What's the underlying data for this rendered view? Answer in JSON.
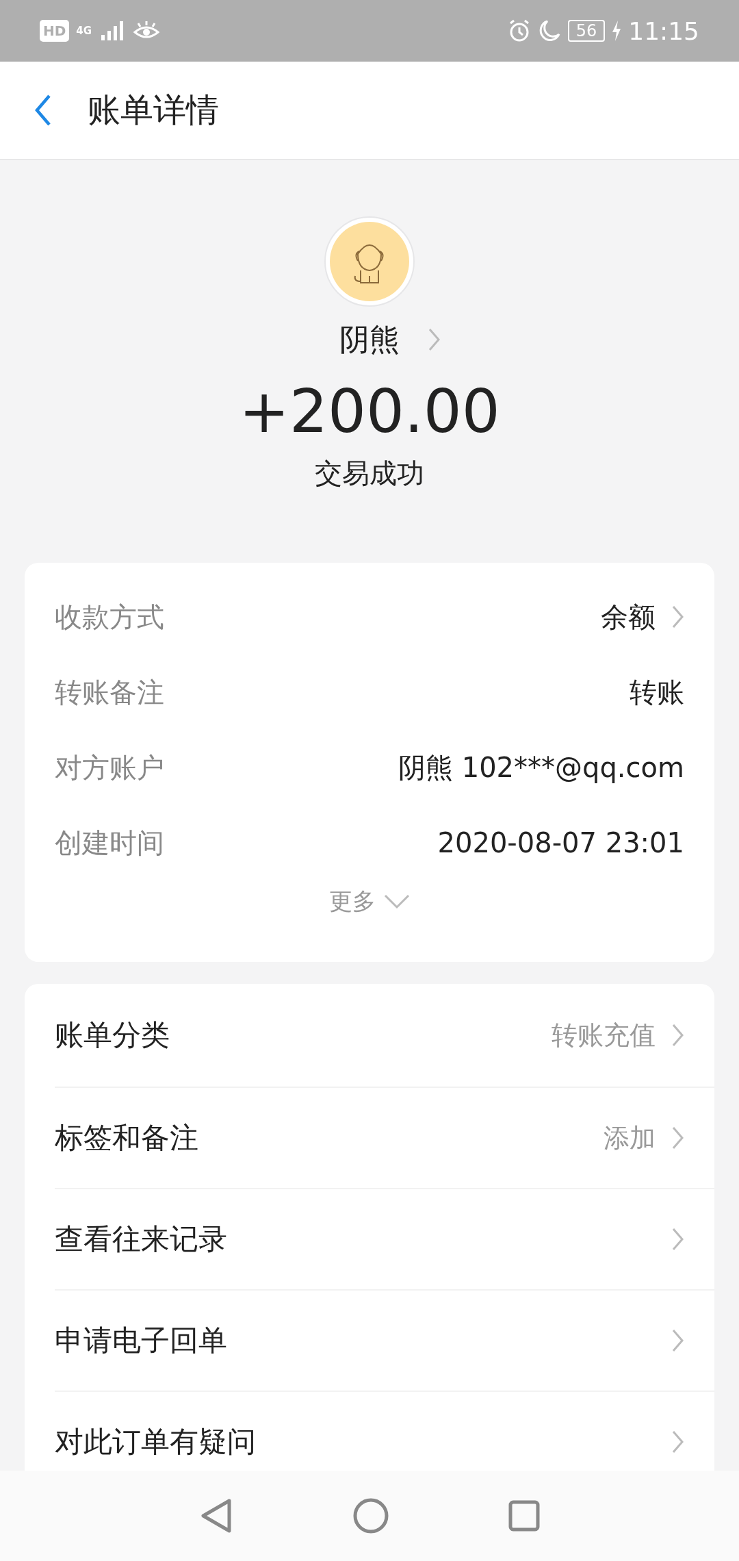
{
  "status_bar": {
    "hd": "HD",
    "battery": "56",
    "time": "11:15",
    "network": "4G"
  },
  "header": {
    "title": "账单详情"
  },
  "summary": {
    "name": "阴熊",
    "amount": "+200.00",
    "status": "交易成功"
  },
  "details": {
    "rows": [
      {
        "label": "收款方式",
        "value": "余额",
        "chevron": true
      },
      {
        "label": "转账备注",
        "value": "转账",
        "chevron": false
      },
      {
        "label": "对方账户",
        "value": "阴熊 102***@qq.com",
        "chevron": false
      },
      {
        "label": "创建时间",
        "value": "2020-08-07 23:01",
        "chevron": false
      }
    ],
    "more": "更多"
  },
  "actions": [
    {
      "label": "账单分类",
      "value": "转账充值"
    },
    {
      "label": "标签和备注",
      "value": "添加"
    },
    {
      "label": "查看往来记录"
    },
    {
      "label": "申请电子回单"
    },
    {
      "label": "对此订单有疑问"
    }
  ]
}
